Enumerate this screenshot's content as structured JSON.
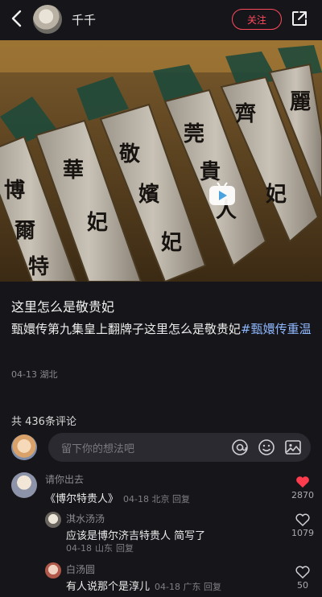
{
  "header": {
    "username": "千千",
    "follow_label": "关注"
  },
  "post": {
    "title": "这里怎么是敬贵妃",
    "description": "甄嬛传第九集皇上翻牌子这里怎么是敬贵妃",
    "hashtag": "#甄嬛传重温",
    "date": "04-13",
    "location": "湖北"
  },
  "comments_section": {
    "count_label": "共 436条评论",
    "input_placeholder": "留下你的想法吧",
    "icons": [
      "at-icon",
      "emoji-icon",
      "image-icon"
    ]
  },
  "comments": [
    {
      "name": "请你出去",
      "text": "《博尔特贵人》",
      "date": "04-18",
      "location": "北京",
      "reply": "回复",
      "likes": "2870",
      "liked": true,
      "accent": "#ff3b4e"
    },
    {
      "name": "淇水汤汤",
      "text": "应该是博尔济吉特贵人 简写了",
      "date": "04-18",
      "location": "山东",
      "reply": "回复",
      "likes": "1079",
      "liked": false
    },
    {
      "name": "白汤圆",
      "text": "有人说那个是淳儿",
      "date": "04-18",
      "location": "广东",
      "reply": "回复",
      "likes": "50",
      "liked": false
    }
  ],
  "video": {
    "tiles": [
      "華妃",
      "敬嬪妃",
      "莞貴人",
      "齊妃",
      "博爾特貴人",
      "麗"
    ]
  }
}
